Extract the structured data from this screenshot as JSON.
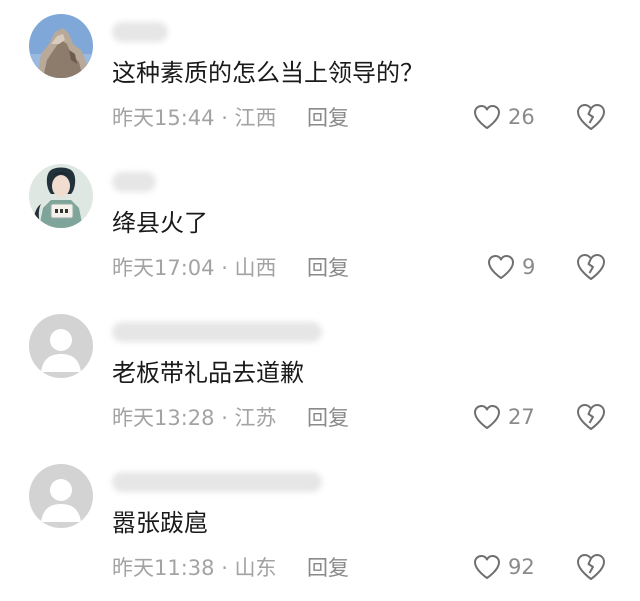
{
  "comments": [
    {
      "text": "这种素质的怎么当上领导的？",
      "meta": "昨天15:44 · 江西",
      "reply_label": "回复",
      "likes": "26",
      "avatar_type": "rock-photo"
    },
    {
      "text": "绛县火了",
      "meta": "昨天17:04 · 山西",
      "reply_label": "回复",
      "likes": "9",
      "avatar_type": "illustrated-person"
    },
    {
      "text": "老板带礼品去道歉",
      "meta": "昨天13:28 · 江苏",
      "reply_label": "回复",
      "likes": "27",
      "avatar_type": "default-gray"
    },
    {
      "text": "嚣张跋扈",
      "meta": "昨天11:38 · 山东",
      "reply_label": "回复",
      "likes": "92",
      "avatar_type": "default-gray"
    }
  ],
  "colors": {
    "text_primary": "#1a1a1a",
    "text_meta": "#a3a3a3",
    "icon_stroke": "#6f6f6f",
    "default_avatar_bg": "#d3d3d3"
  }
}
